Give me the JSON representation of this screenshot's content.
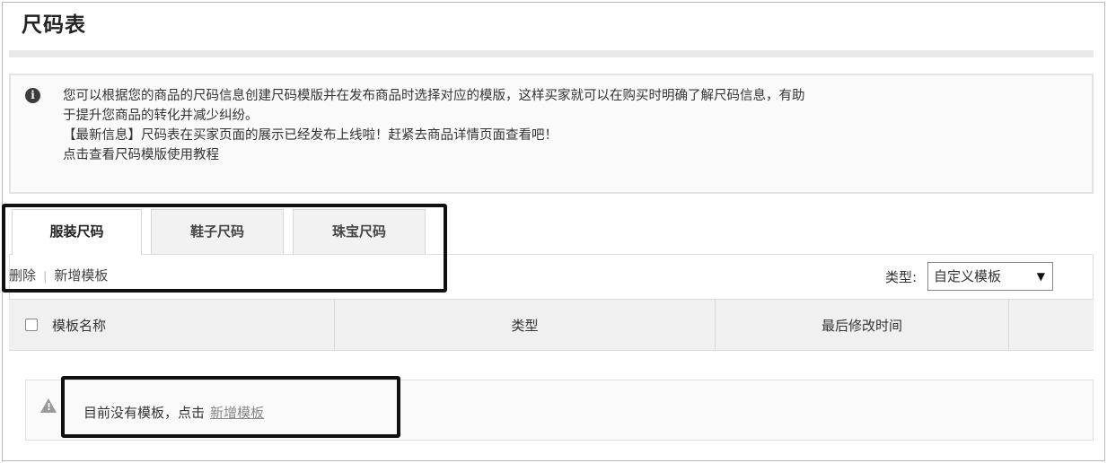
{
  "page": {
    "title": "尺码表"
  },
  "notice": {
    "line1": "您可以根据您的商品的尺码信息创建尺码模版并在发布商品时选择对应的模版，这样买家就可以在购买时明确了解尺码信息，有助",
    "line2": "于提升您商品的转化并减少纠纷。",
    "line3": "【最新信息】尺码表在买家页面的展示已经发布上线啦！赶紧去商品详情页面查看吧！",
    "line4": "点击查看尺码模版使用教程"
  },
  "tabs": [
    {
      "label": "服装尺码",
      "active": true
    },
    {
      "label": "鞋子尺码",
      "active": false
    },
    {
      "label": "珠宝尺码",
      "active": false
    }
  ],
  "actions": {
    "delete": "删除",
    "separator": "|",
    "add": "新增模板"
  },
  "filter": {
    "label": "类型:",
    "selected": "自定义模板"
  },
  "table": {
    "headers": {
      "name": "模板名称",
      "type": "类型",
      "modified": "最后修改时间"
    }
  },
  "empty": {
    "text": "目前没有模板，点击",
    "link": "新增模板"
  },
  "colors": {
    "annotation": "#111111",
    "header_bg": "#f0f0f0",
    "notice_bg": "#fafafa"
  }
}
